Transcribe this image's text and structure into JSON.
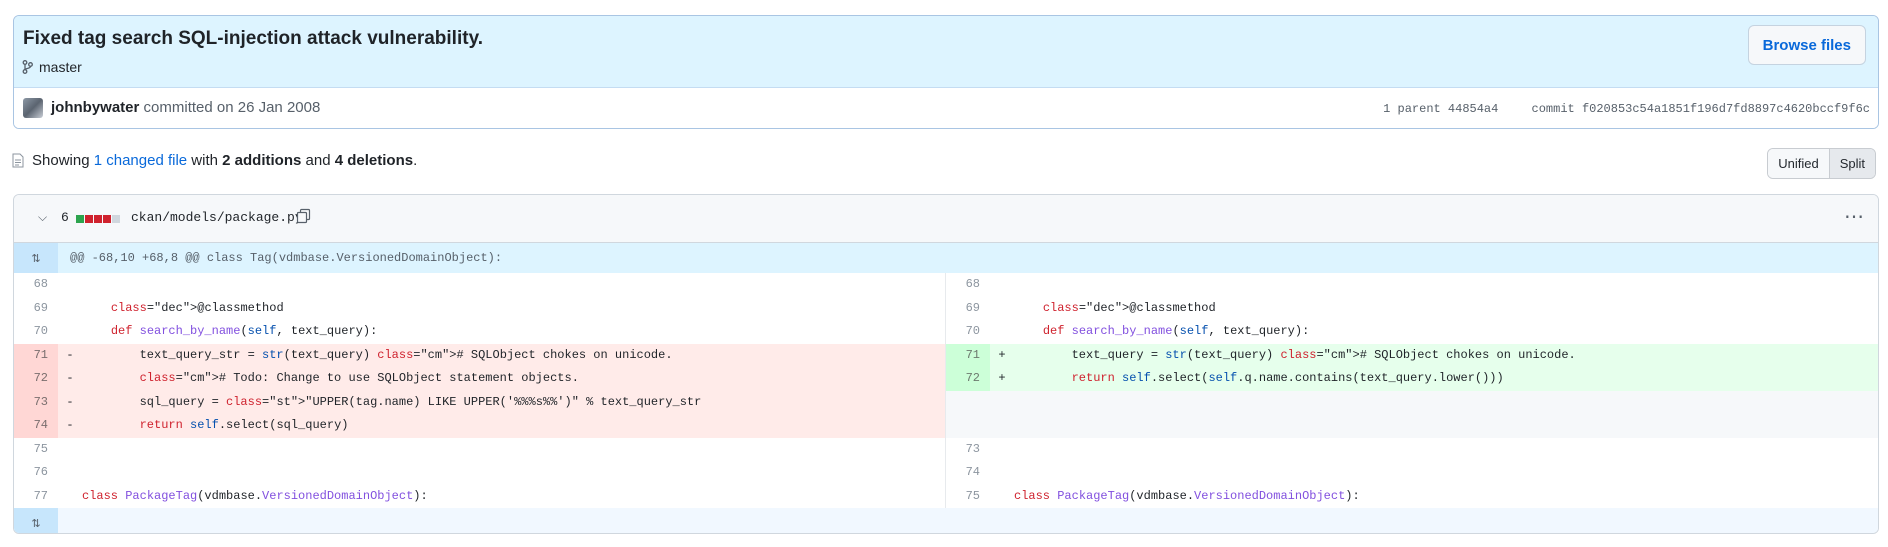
{
  "commit": {
    "title": "Fixed tag search SQL-injection attack vulnerability.",
    "branch": "master",
    "browse_label": "Browse files",
    "author": "johnbywater",
    "committed_text": "committed on 26 Jan 2008",
    "parent_label": "1 parent 44854a4",
    "commit_label": "commit f020853c54a1851f196d7fd8897c4620bccf9f6c"
  },
  "summary": {
    "showing": "Showing",
    "changed_files": "1 changed file",
    "with": "with",
    "additions": "2 additions",
    "and": "and",
    "deletions": "4 deletions",
    "period": "."
  },
  "view_toggle": {
    "unified": "Unified",
    "split": "Split"
  },
  "file": {
    "change_count": "6",
    "path": "ckan/models/package.py",
    "hunk_header": "@@ -68,10 +68,8 @@ class Tag(vdmbase.VersionedDomainObject):",
    "left": [
      {
        "ln": "68",
        "mk": "",
        "code": ""
      },
      {
        "ln": "69",
        "mk": "",
        "code": "    @classmethod"
      },
      {
        "ln": "70",
        "mk": "",
        "code": "    def search_by_name(self, text_query):"
      },
      {
        "ln": "71",
        "mk": "-",
        "code": "        text_query_str = str(text_query) # SQLObject chokes on unicode."
      },
      {
        "ln": "72",
        "mk": "-",
        "code": "        # Todo: Change to use SQLObject statement objects."
      },
      {
        "ln": "73",
        "mk": "-",
        "code": "        sql_query = \"UPPER(tag.name) LIKE UPPER('%%%s%%')\" % text_query_str"
      },
      {
        "ln": "74",
        "mk": "-",
        "code": "        return self.select(sql_query)"
      },
      {
        "ln": "75",
        "mk": "",
        "code": ""
      },
      {
        "ln": "76",
        "mk": "",
        "code": ""
      },
      {
        "ln": "77",
        "mk": "",
        "code": "class PackageTag(vdmbase.VersionedDomainObject):"
      }
    ],
    "right": [
      {
        "ln": "68",
        "mk": "",
        "code": ""
      },
      {
        "ln": "69",
        "mk": "",
        "code": "    @classmethod"
      },
      {
        "ln": "70",
        "mk": "",
        "code": "    def search_by_name(self, text_query):"
      },
      {
        "ln": "71",
        "mk": "+",
        "code": "        text_query = str(text_query) # SQLObject chokes on unicode."
      },
      {
        "ln": "72",
        "mk": "+",
        "code": "        return self.select(self.q.name.contains(text_query.lower()))"
      },
      {
        "ln": "",
        "mk": "",
        "code": ""
      },
      {
        "ln": "",
        "mk": "",
        "code": ""
      },
      {
        "ln": "73",
        "mk": "",
        "code": ""
      },
      {
        "ln": "74",
        "mk": "",
        "code": ""
      },
      {
        "ln": "75",
        "mk": "",
        "code": "class PackageTag(vdmbase.VersionedDomainObject):"
      }
    ]
  },
  "colors": {
    "accent": "#0969da",
    "deletion": "#cf222e",
    "addition": "#2da44e",
    "header_bg": "#ddf4ff"
  },
  "icons": [
    "branch-icon",
    "avatar",
    "file-icon",
    "chevron-down-icon",
    "copy-icon",
    "kebab-icon",
    "expand-icon"
  ]
}
